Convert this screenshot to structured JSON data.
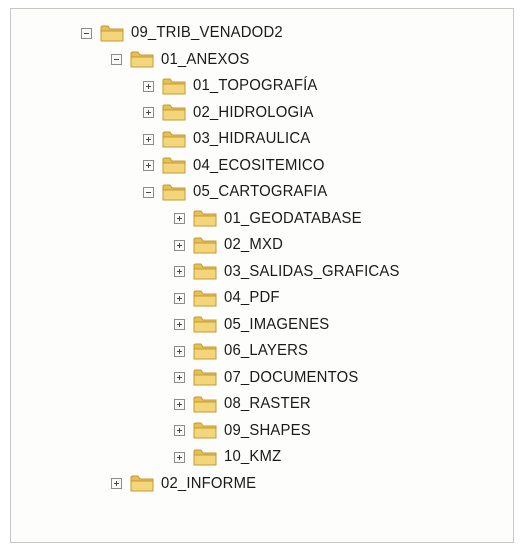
{
  "tree": {
    "root": {
      "label": "09_TRIB_VENADOD2",
      "toggle": "minus"
    },
    "anexos": {
      "label": "01_ANEXOS",
      "toggle": "minus"
    },
    "anexos_children": [
      {
        "label": "01_TOPOGRAFÍA",
        "toggle": "plus"
      },
      {
        "label": "02_HIDROLOGIA",
        "toggle": "plus"
      },
      {
        "label": "03_HIDRAULICA",
        "toggle": "plus"
      },
      {
        "label": "04_ECOSITEMICO",
        "toggle": "plus"
      },
      {
        "label": "05_CARTOGRAFIA",
        "toggle": "minus"
      }
    ],
    "cartografia_children": [
      {
        "label": "01_GEODATABASE",
        "toggle": "plus"
      },
      {
        "label": "02_MXD",
        "toggle": "plus"
      },
      {
        "label": "03_SALIDAS_GRAFICAS",
        "toggle": "plus"
      },
      {
        "label": "04_PDF",
        "toggle": "plus"
      },
      {
        "label": "05_IMAGENES",
        "toggle": "plus"
      },
      {
        "label": "06_LAYERS",
        "toggle": "plus"
      },
      {
        "label": "07_DOCUMENTOS",
        "toggle": "plus"
      },
      {
        "label": "08_RASTER",
        "toggle": "plus"
      },
      {
        "label": "09_SHAPES",
        "toggle": "plus"
      },
      {
        "label": "10_KMZ",
        "toggle": "plus"
      }
    ],
    "informe": {
      "label": "02_INFORME",
      "toggle": "plus"
    }
  },
  "colors": {
    "folder_fill": "#f3d67c",
    "folder_back": "#e6bf55",
    "folder_stroke": "#c49a32",
    "text": "#1a1a1a"
  },
  "icons": {
    "expand": "plus-box-icon",
    "collapse": "minus-box-icon",
    "folder": "folder-icon"
  }
}
